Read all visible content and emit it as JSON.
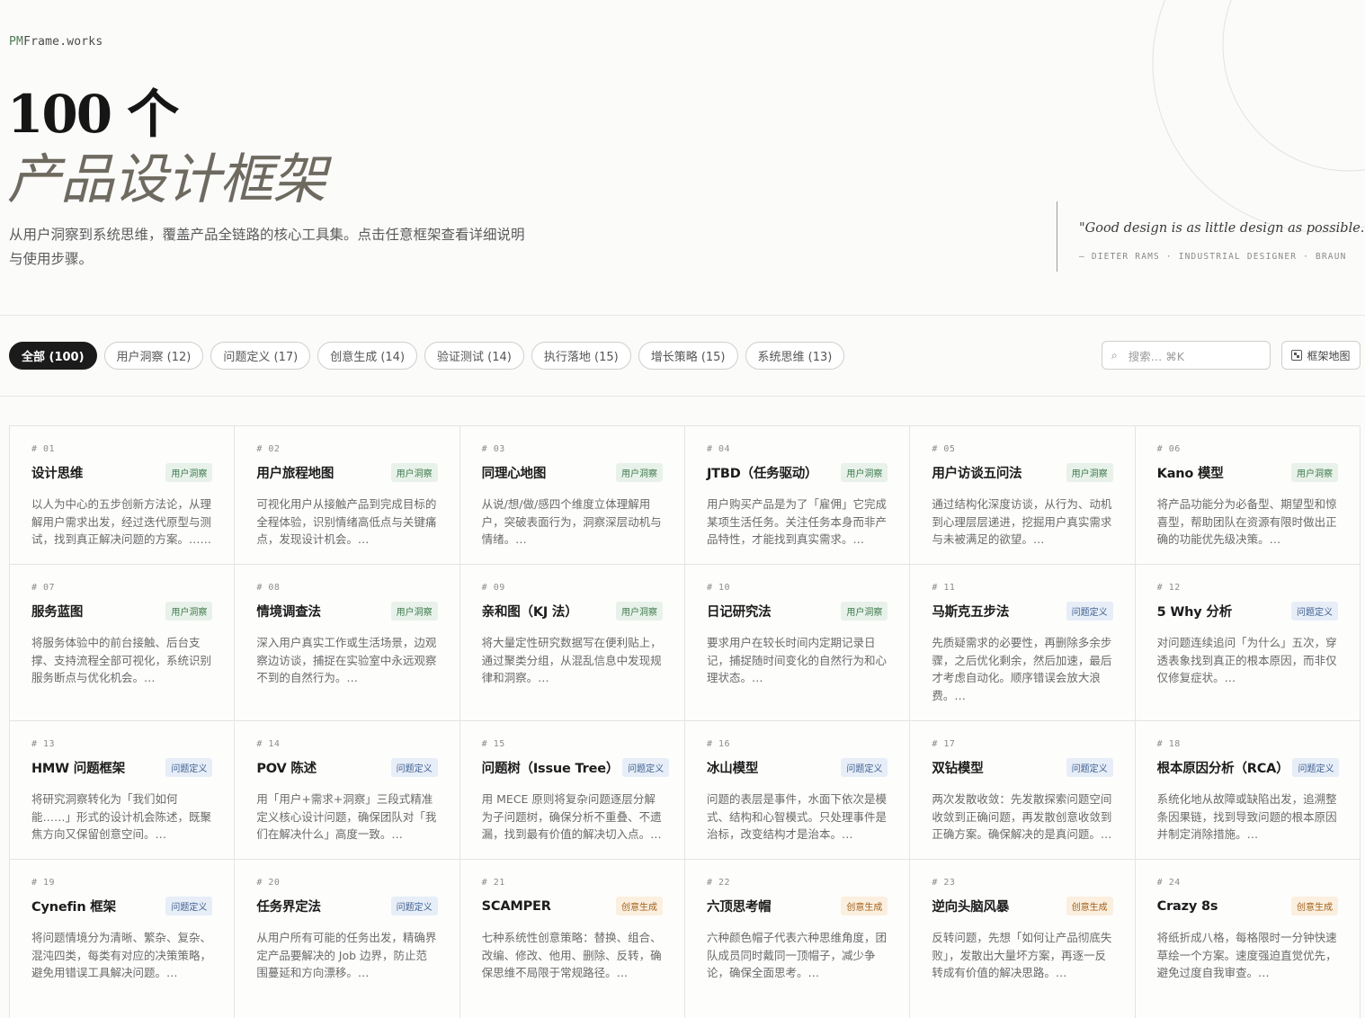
{
  "brand": {
    "prefix": "PM",
    "suffix": "Frame.works"
  },
  "hero": {
    "title": "100 个",
    "subtitle": "产品设计框架",
    "description": "从用户洞察到系统思维，覆盖产品全链路的核心工具集。点击任意框架查看详细说明与使用步骤。"
  },
  "quote": {
    "text": "\"Good design is as little design as possible.\"",
    "author": "— DIETER RAMS · INDUSTRIAL DESIGNER · BRAUN"
  },
  "filters": [
    {
      "label": "全部 (100)",
      "active": true
    },
    {
      "label": "用户洞察 (12)",
      "active": false
    },
    {
      "label": "问题定义 (17)",
      "active": false
    },
    {
      "label": "创意生成 (14)",
      "active": false
    },
    {
      "label": "验证测试 (14)",
      "active": false
    },
    {
      "label": "执行落地 (15)",
      "active": false
    },
    {
      "label": "增长策略 (15)",
      "active": false
    },
    {
      "label": "系统思维 (13)",
      "active": false
    }
  ],
  "search": {
    "placeholder": "搜索… ⌘K",
    "icon": "search-icon"
  },
  "map_button": {
    "label": "框架地图",
    "icon": "map-icon"
  },
  "tag_colors": {
    "green": "#3e7a4c",
    "blue": "#3e5f8f",
    "orange": "#a2621f"
  },
  "frameworks": [
    {
      "num": "# 01",
      "title": "设计思维",
      "tag": "用户洞察",
      "tone": "green",
      "desc": "以人为中心的五步创新方法论，从理解用户需求出发，经过迭代原型与测试，找到真正解决问题的方案。……"
    },
    {
      "num": "# 02",
      "title": "用户旅程地图",
      "tag": "用户洞察",
      "tone": "green",
      "desc": "可视化用户从接触产品到完成目标的全程体验，识别情绪高低点与关键痛点，发现设计机会。…"
    },
    {
      "num": "# 03",
      "title": "同理心地图",
      "tag": "用户洞察",
      "tone": "green",
      "desc": "从说/想/做/感四个维度立体理解用户，突破表面行为，洞察深层动机与情绪。…"
    },
    {
      "num": "# 04",
      "title": "JTBD（任务驱动）",
      "tag": "用户洞察",
      "tone": "green",
      "desc": "用户购买产品是为了「雇佣」它完成某项生活任务。关注任务本身而非产品特性，才能找到真实需求。…"
    },
    {
      "num": "# 05",
      "title": "用户访谈五问法",
      "tag": "用户洞察",
      "tone": "green",
      "desc": "通过结构化深度访谈，从行为、动机到心理层层递进，挖掘用户真实需求与未被满足的欲望。…"
    },
    {
      "num": "# 06",
      "title": "Kano 模型",
      "tag": "用户洞察",
      "tone": "green",
      "desc": "将产品功能分为必备型、期望型和惊喜型，帮助团队在资源有限时做出正确的功能优先级决策。…"
    },
    {
      "num": "# 07",
      "title": "服务蓝图",
      "tag": "用户洞察",
      "tone": "green",
      "desc": "将服务体验中的前台接触、后台支撑、支持流程全部可视化，系统识别服务断点与优化机会。…"
    },
    {
      "num": "# 08",
      "title": "情境调查法",
      "tag": "用户洞察",
      "tone": "green",
      "desc": "深入用户真实工作或生活场景，边观察边访谈，捕捉在实验室中永远观察不到的自然行为。…"
    },
    {
      "num": "# 09",
      "title": "亲和图（KJ 法）",
      "tag": "用户洞察",
      "tone": "green",
      "desc": "将大量定性研究数据写在便利贴上，通过聚类分组，从混乱信息中发现规律和洞察。…"
    },
    {
      "num": "# 10",
      "title": "日记研究法",
      "tag": "用户洞察",
      "tone": "green",
      "desc": "要求用户在较长时间内定期记录日记，捕捉随时间变化的自然行为和心理状态。…"
    },
    {
      "num": "# 11",
      "title": "马斯克五步法",
      "tag": "问题定义",
      "tone": "blue",
      "desc": "先质疑需求的必要性，再删除多余步骤，之后优化剩余，然后加速，最后才考虑自动化。顺序错误会放大浪费。…"
    },
    {
      "num": "# 12",
      "title": "5 Why 分析",
      "tag": "问题定义",
      "tone": "blue",
      "desc": "对问题连续追问「为什么」五次，穿透表象找到真正的根本原因，而非仅仅修复症状。…"
    },
    {
      "num": "# 13",
      "title": "HMW 问题框架",
      "tag": "问题定义",
      "tone": "blue",
      "desc": "将研究洞察转化为「我们如何能……」形式的设计机会陈述，既聚焦方向又保留创意空间。…"
    },
    {
      "num": "# 14",
      "title": "POV 陈述",
      "tag": "问题定义",
      "tone": "blue",
      "desc": "用「用户+需求+洞察」三段式精准定义核心设计问题，确保团队对「我们在解决什么」高度一致。…"
    },
    {
      "num": "# 15",
      "title": "问题树（Issue Tree）",
      "tag": "问题定义",
      "tone": "blue",
      "desc": "用 MECE 原则将复杂问题逐层分解为子问题树，确保分析不重叠、不遗漏，找到最有价值的解决切入点。…"
    },
    {
      "num": "# 16",
      "title": "冰山模型",
      "tag": "问题定义",
      "tone": "blue",
      "desc": "问题的表层是事件，水面下依次是模式、结构和心智模式。只处理事件是治标，改变结构才是治本。…"
    },
    {
      "num": "# 17",
      "title": "双钻模型",
      "tag": "问题定义",
      "tone": "blue",
      "desc": "两次发散收敛：先发散探索问题空间收敛到正确问题，再发散创意收敛到正确方案。确保解决的是真问题。…"
    },
    {
      "num": "# 18",
      "title": "根本原因分析（RCA）",
      "tag": "问题定义",
      "tone": "blue",
      "desc": "系统化地从故障或缺陷出发，追溯整条因果链，找到导致问题的根本原因并制定消除措施。…"
    },
    {
      "num": "# 19",
      "title": "Cynefin 框架",
      "tag": "问题定义",
      "tone": "blue",
      "desc": "将问题情境分为清晰、繁杂、复杂、混沌四类，每类有对应的决策策略，避免用错误工具解决问题。…"
    },
    {
      "num": "# 20",
      "title": "任务界定法",
      "tag": "问题定义",
      "tone": "blue",
      "desc": "从用户所有可能的任务出发，精确界定产品要解决的 Job 边界，防止范围蔓延和方向漂移。…"
    },
    {
      "num": "# 21",
      "title": "SCAMPER",
      "tag": "创意生成",
      "tone": "orange",
      "desc": "七种系统性创意策略：替换、组合、改编、修改、他用、删除、反转，确保思维不局限于常规路径。…"
    },
    {
      "num": "# 22",
      "title": "六顶思考帽",
      "tag": "创意生成",
      "tone": "orange",
      "desc": "六种颜色帽子代表六种思维角度，团队成员同时戴同一顶帽子，减少争论，确保全面思考。…"
    },
    {
      "num": "# 23",
      "title": "逆向头脑风暴",
      "tag": "创意生成",
      "tone": "orange",
      "desc": "反转问题，先想「如何让产品彻底失败」，发散出大量坏方案，再逐一反转成有价值的解决思路。…"
    },
    {
      "num": "# 24",
      "title": "Crazy 8s",
      "tag": "创意生成",
      "tone": "orange",
      "desc": "将纸折成八格，每格限时一分钟快速草绘一个方案。速度强迫直觉优先，避免过度自我审查。…"
    }
  ]
}
